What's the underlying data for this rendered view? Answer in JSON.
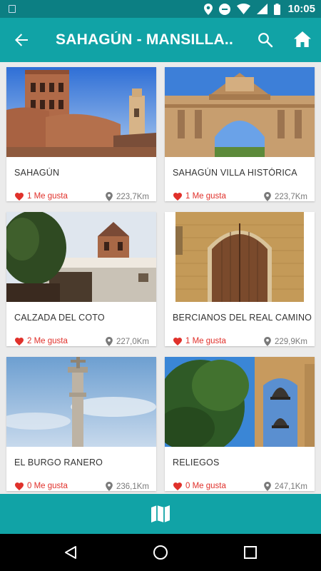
{
  "status_bar": {
    "time": "10:05",
    "icons": [
      "notification-icon",
      "location-icon",
      "do-not-disturb-icon",
      "wifi-icon",
      "cell-signal-icon",
      "battery-icon"
    ]
  },
  "app_bar": {
    "title": "SAHAGÚN - MANSILLA...",
    "back_icon": "arrow-left-icon",
    "search_icon": "search-icon",
    "home_icon": "home-icon"
  },
  "places": [
    {
      "name": "SAHAGÚN",
      "likes": "1 Me gusta",
      "distance": "223,7Km",
      "photo": "brick-church-tower"
    },
    {
      "name": "SAHAGÚN VILLA HISTÓRICA",
      "likes": "1 Me gusta",
      "distance": "223,7Km",
      "photo": "stone-arch"
    },
    {
      "name": "CALZADA DEL COTO",
      "likes": "2 Me gusta",
      "distance": "227,0Km",
      "photo": "village-church-tree"
    },
    {
      "name": "BERCIANOS DEL REAL CAMINO",
      "likes": "1 Me gusta",
      "distance": "229,9Km",
      "photo": "wooden-door"
    },
    {
      "name": "EL BURGO RANERO",
      "likes": "0 Me gusta",
      "distance": "236,1Km",
      "photo": "stone-cross-column"
    },
    {
      "name": "RELIEGOS",
      "likes": "0 Me gusta",
      "distance": "247,1Km",
      "photo": "bell-tower-pine"
    }
  ],
  "bottom_bar": {
    "icon": "map-icon"
  },
  "nav_bar": {
    "icons": [
      "back-triangle-icon",
      "home-circle-icon",
      "recents-square-icon"
    ]
  },
  "colors": {
    "primary": "#11a3a6",
    "status_bar": "#0c7f83",
    "like": "#e0312b",
    "distance": "#7a7a7a"
  }
}
